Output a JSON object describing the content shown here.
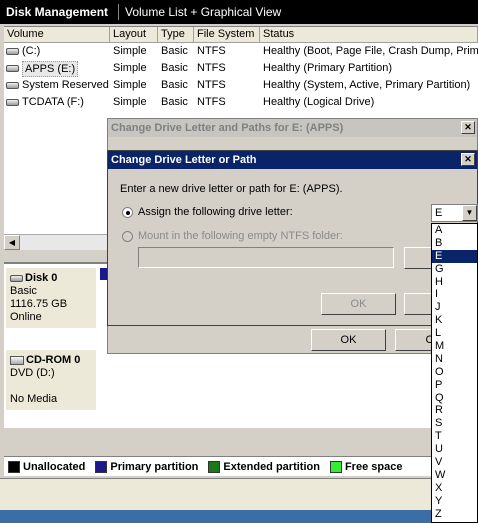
{
  "header": {
    "app_title": "Disk Management",
    "view_label": "Volume List + Graphical View"
  },
  "volume_list": {
    "columns": [
      "Volume",
      "Layout",
      "Type",
      "File System",
      "Status"
    ],
    "rows": [
      {
        "volume": "(C:)",
        "layout": "Simple",
        "type": "Basic",
        "fs": "NTFS",
        "status": "Healthy (Boot, Page File, Crash Dump, Prima"
      },
      {
        "volume": "APPS (E:)",
        "layout": "Simple",
        "type": "Basic",
        "fs": "NTFS",
        "status": "Healthy (Primary Partition)"
      },
      {
        "volume": "System Reserved",
        "layout": "Simple",
        "type": "Basic",
        "fs": "NTFS",
        "status": "Healthy (System, Active, Primary Partition)"
      },
      {
        "volume": "TCDATA (F:)",
        "layout": "Simple",
        "type": "Basic",
        "fs": "NTFS",
        "status": "Healthy (Logical Drive)"
      }
    ]
  },
  "disks": [
    {
      "name": "Disk 0",
      "type": "Basic",
      "size": "1116.75 GB",
      "state": "Online"
    },
    {
      "name": "CD-ROM 0",
      "type": "DVD (D:)",
      "size": "",
      "state": "No Media"
    }
  ],
  "legend": [
    {
      "label": "Unallocated",
      "color": "#000000"
    },
    {
      "label": "Primary partition",
      "color": "#1a1a8a"
    },
    {
      "label": "Extended partition",
      "color": "#1a7a1a"
    },
    {
      "label": "Free space",
      "color": "#33ee33"
    }
  ],
  "outer_dialog": {
    "title": "Change Drive Letter and Paths for E: (APPS)",
    "ok_label": "OK",
    "cancel_label": "Ca"
  },
  "inner_dialog": {
    "title": "Change Drive Letter or Path",
    "prompt": "Enter a new drive letter or path for E: (APPS).",
    "option_assign": "Assign the following drive letter:",
    "option_mount": "Mount in the following empty NTFS folder:",
    "browse_label": "Bro",
    "ok_label": "OK",
    "cancel_label": "C",
    "selected_letter": "E",
    "letters": [
      "A",
      "B",
      "E",
      "G",
      "H",
      "I",
      "J",
      "K",
      "L",
      "M",
      "N",
      "O",
      "P",
      "Q",
      "R",
      "S",
      "T",
      "U",
      "V",
      "W",
      "X",
      "Y",
      "Z"
    ]
  }
}
